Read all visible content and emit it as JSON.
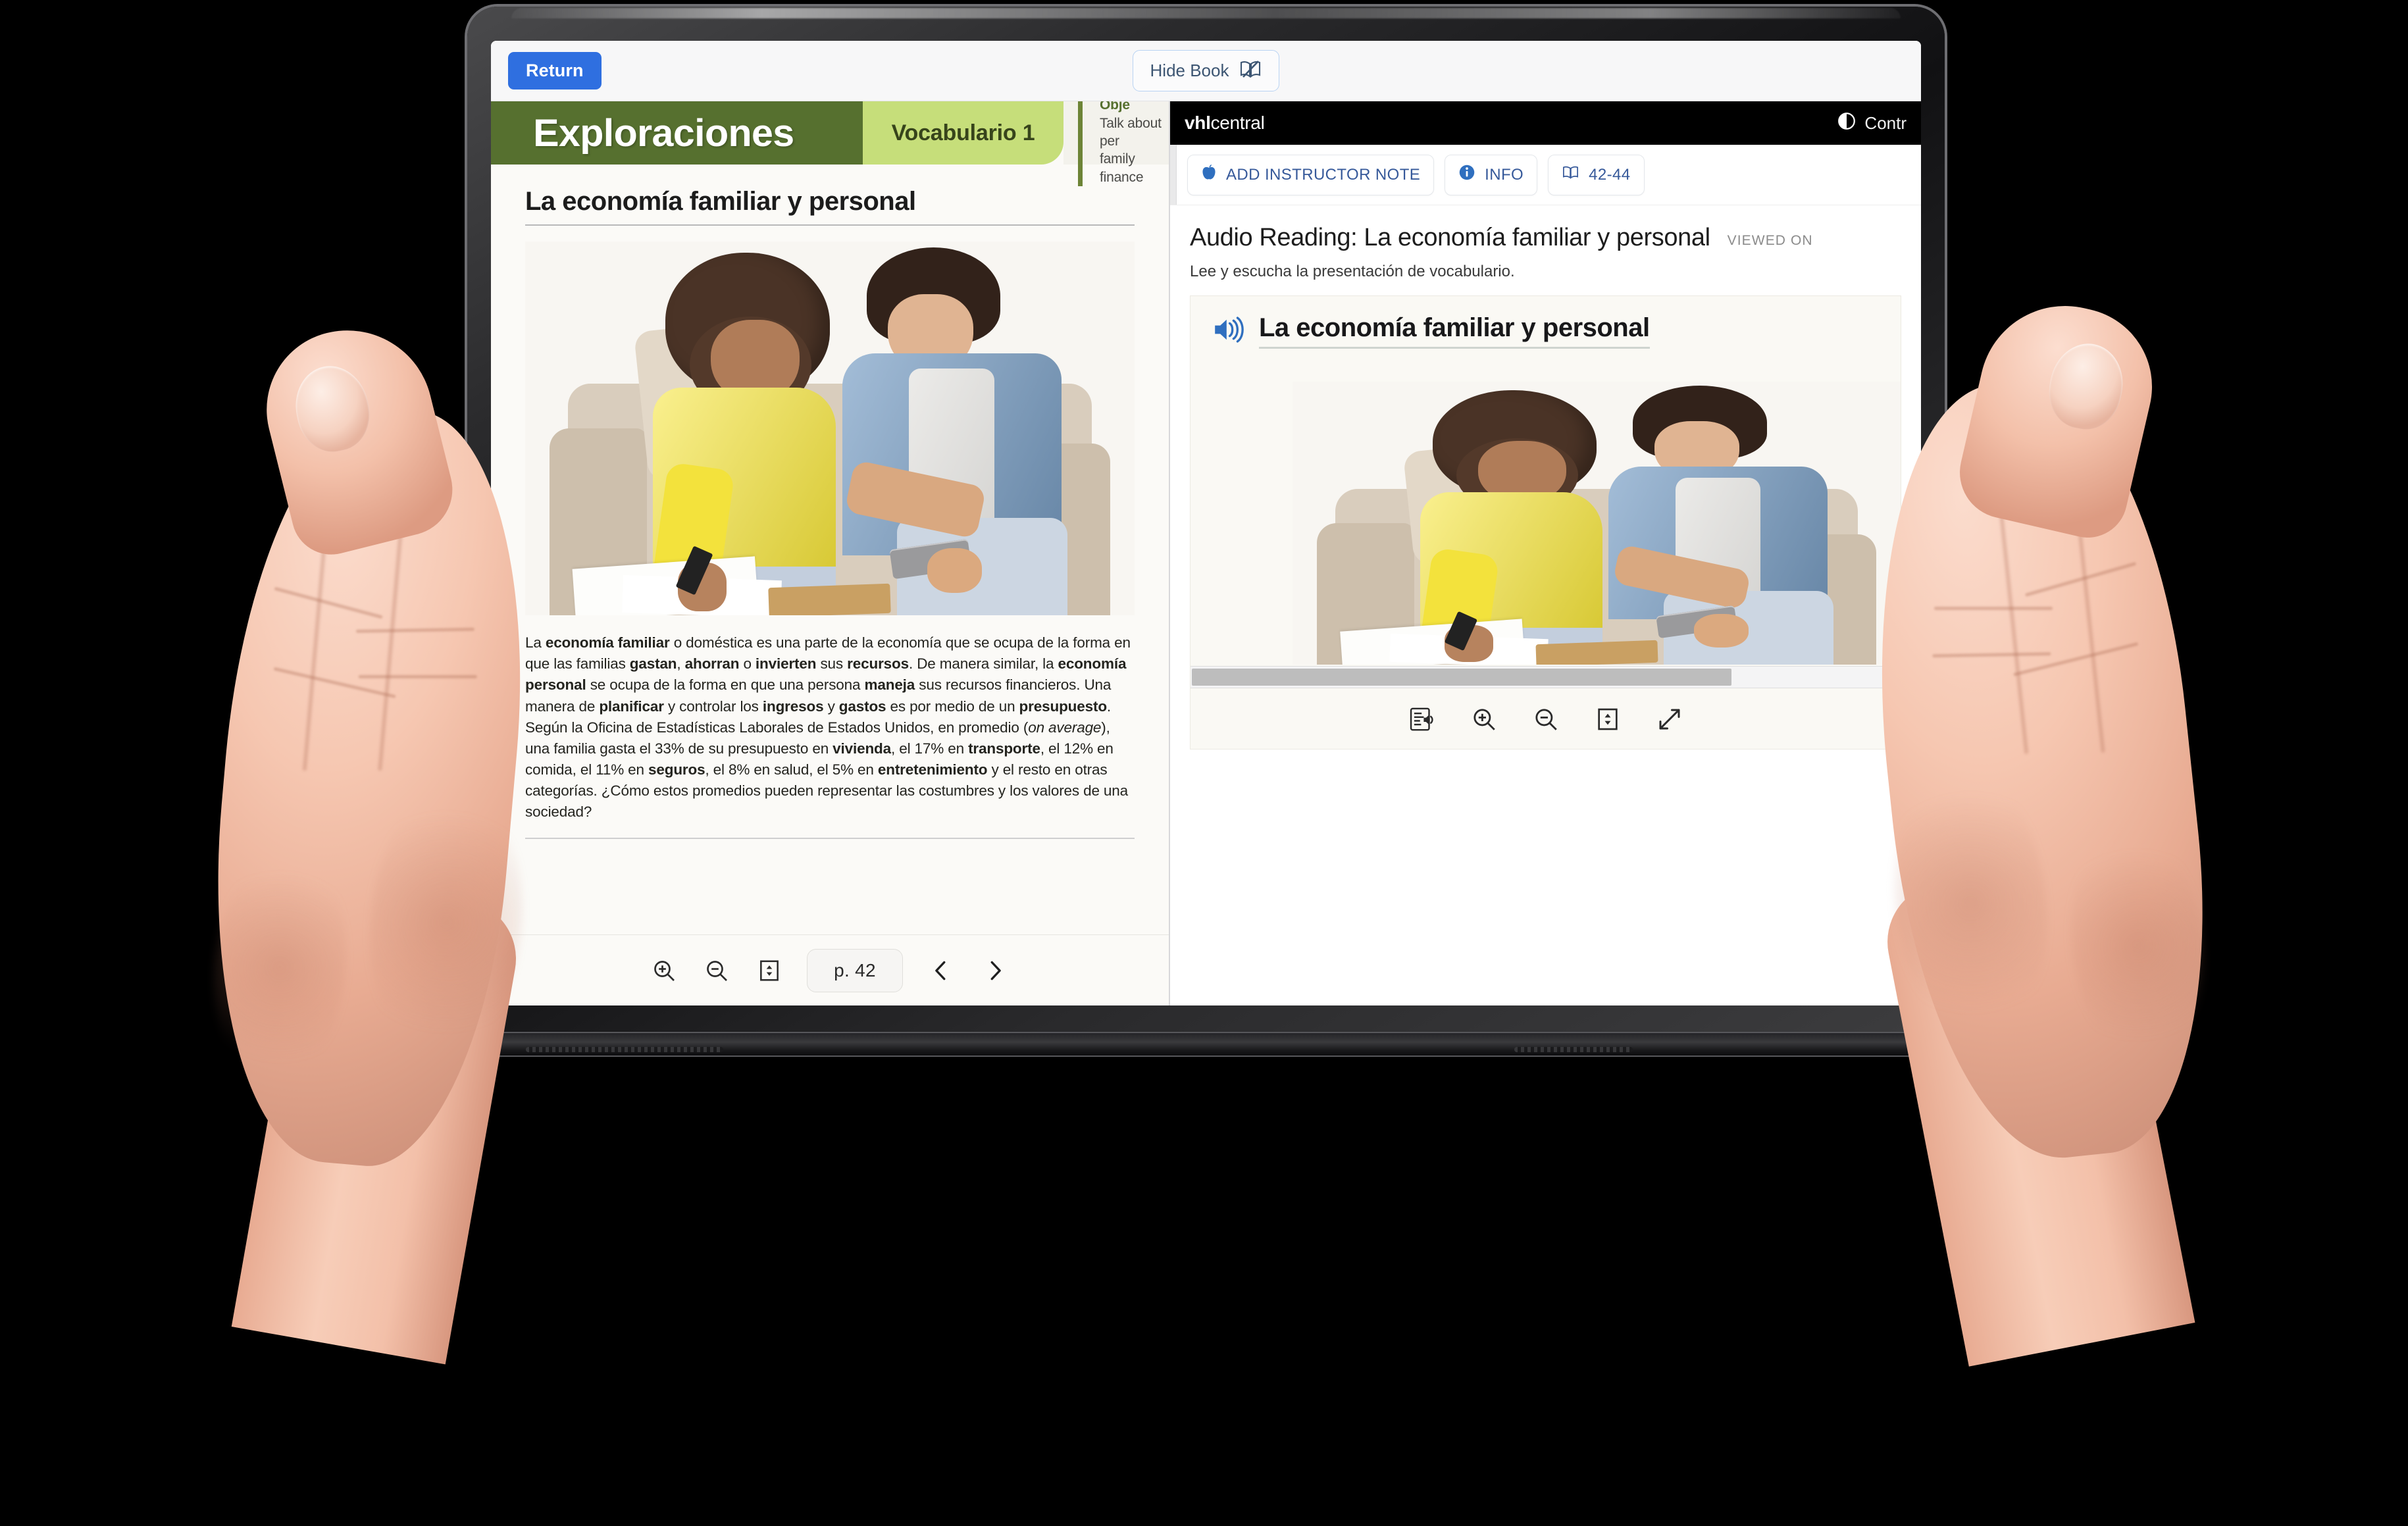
{
  "appbar": {
    "return_label": "Return",
    "hide_book_label": "Hide Book",
    "hide_book_icon": "book-crossed-out-icon"
  },
  "book": {
    "banner": {
      "title": "Exploraciones",
      "section": "Vocabulario 1",
      "learning_objective_label": "Learning Obje",
      "learning_objective_line1": "Talk about per",
      "learning_objective_line2": "family finance"
    },
    "page_heading": "La economía familiar y personal",
    "photo_alt": "couple-reviewing-household-budget-photo",
    "paragraph": [
      {
        "t": "La ",
        "b": false
      },
      {
        "t": "economía familiar",
        "b": true
      },
      {
        "t": " o doméstica es una parte de la economía que se ocupa de la forma en que las familias ",
        "b": false
      },
      {
        "t": "gastan",
        "b": true
      },
      {
        "t": ", ",
        "b": false
      },
      {
        "t": "ahorran",
        "b": true
      },
      {
        "t": " o ",
        "b": false
      },
      {
        "t": "invierten",
        "b": true
      },
      {
        "t": " sus ",
        "b": false
      },
      {
        "t": "recursos",
        "b": true
      },
      {
        "t": ". De manera similar, la ",
        "b": false
      },
      {
        "t": "economía personal",
        "b": true
      },
      {
        "t": " se ocupa de la forma en que una persona ",
        "b": false
      },
      {
        "t": "maneja",
        "b": true
      },
      {
        "t": " sus recursos financieros. Una manera de ",
        "b": false
      },
      {
        "t": "planificar",
        "b": true
      },
      {
        "t": " y controlar los ",
        "b": false
      },
      {
        "t": "ingresos",
        "b": true
      },
      {
        "t": " y ",
        "b": false
      },
      {
        "t": "gastos",
        "b": true
      },
      {
        "t": " es por medio de un ",
        "b": false
      },
      {
        "t": "presupuesto",
        "b": true
      },
      {
        "t": ". Según la Oficina de Estadísticas Laborales de Estados Unidos, en promedio (",
        "b": false
      },
      {
        "t": "on average",
        "b": false,
        "i": true
      },
      {
        "t": "), una familia gasta el 33% de su presupuesto en ",
        "b": false
      },
      {
        "t": "vivienda",
        "b": true
      },
      {
        "t": ", el 17% en ",
        "b": false
      },
      {
        "t": "transporte",
        "b": true
      },
      {
        "t": ", el 12% en comida, el 11% en ",
        "b": false
      },
      {
        "t": "seguros",
        "b": true
      },
      {
        "t": ", el 8% en salud, el 5% en ",
        "b": false
      },
      {
        "t": "entretenimiento",
        "b": true
      },
      {
        "t": " y el resto en otras categorías. ¿Cómo estos promedios pueden representar las costumbres y los valores de una sociedad?",
        "b": false
      }
    ],
    "toolbar": {
      "zoom_in_icon": "zoom-in-icon",
      "zoom_out_icon": "zoom-out-icon",
      "fit_height_icon": "fit-height-icon",
      "page_label": "p. 42",
      "prev_icon": "chevron-left-icon",
      "next_icon": "chevron-right-icon"
    }
  },
  "vhl": {
    "logo_bold": "vhl",
    "logo_rest": "central",
    "contrast_label": "Contr",
    "contrast_icon": "contrast-icon",
    "actions": [
      {
        "label": "ADD INSTRUCTOR NOTE",
        "icon": "apple-icon"
      },
      {
        "label": "INFO",
        "icon": "info-icon"
      },
      {
        "label": "42-44",
        "icon": "book-pages-icon"
      }
    ],
    "activity": {
      "title": "Audio Reading: La economía familiar y personal",
      "viewed_badge": "VIEWED ON",
      "instruction": "Lee y escucha la presentación de vocabulario.",
      "card_title": "La economía familiar y personal",
      "speaker_icon": "speaker-wave-icon",
      "photo_alt": "couple-reviewing-household-budget-photo"
    },
    "scrollbar": {
      "left_arrow_icon": "chevron-left-icon"
    },
    "tools": [
      {
        "icon": "audio-transcript-icon",
        "name": "audio-transcript-button"
      },
      {
        "icon": "zoom-in-icon",
        "name": "zoom-in-button"
      },
      {
        "icon": "zoom-out-icon",
        "name": "zoom-out-button"
      },
      {
        "icon": "fit-height-icon",
        "name": "fit-height-button"
      },
      {
        "icon": "expand-icon",
        "name": "fullscreen-button"
      }
    ]
  },
  "colors": {
    "accent_blue": "#2f6fe0",
    "banner_dark_green": "#56702f",
    "banner_light_green": "#c6de7a",
    "topbar_black": "#000000",
    "sweater_yellow": "#f6e53d",
    "shirt_denim": "#7ba0c6"
  }
}
